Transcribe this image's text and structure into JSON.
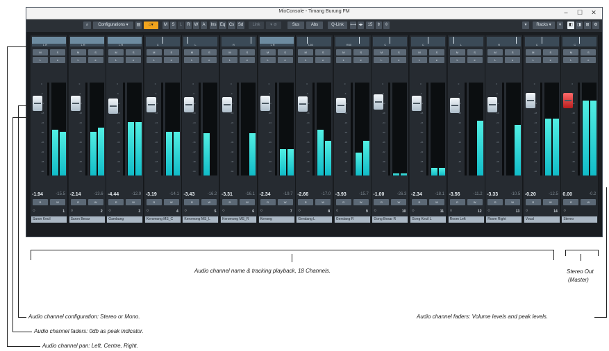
{
  "window": {
    "title": "MixConsole - Timang Burung FM",
    "controls": [
      "–",
      "☐",
      "✕"
    ]
  },
  "toolbar": {
    "configurations_label": "Configurations",
    "buttons_left": [
      "M",
      "S",
      "L",
      "R",
      "W",
      "A"
    ],
    "buttons_sections": [
      "Ins",
      "Eq",
      "Cs",
      "Sd"
    ],
    "link_label": "Link",
    "sus_label": "Sus",
    "abs_label": "Abs",
    "qlink_label": "Q-Link",
    "zoom_value": "15",
    "racks_label": "Racks",
    "colors": {
      "accent": "#f1a41d",
      "meter": "#22d3d8",
      "bg": "#1a1d21",
      "name_bg": "#aab7c4"
    }
  },
  "strip_buttons": {
    "mute": "M",
    "solo": "S",
    "listen": "L",
    "edit": "e",
    "read": "R",
    "write": "W"
  },
  "channels": [
    {
      "name": "Saron Kecil",
      "number": "1",
      "volume": "-1.94",
      "peak": "-15.5",
      "pan": "L R",
      "fader_db": -1.94,
      "meter": [
        0.5,
        0.48
      ]
    },
    {
      "name": "Saron Besar",
      "number": "2",
      "volume": "-2.14",
      "peak": "-13.6",
      "pan": "L R",
      "fader_db": -2.14,
      "meter": [
        0.48,
        0.52
      ]
    },
    {
      "name": "Gambang",
      "number": "3",
      "volume": "-4.44",
      "peak": "-12.9",
      "pan": "L R",
      "fader_db": -4.44,
      "meter": [
        0.58,
        0.58
      ]
    },
    {
      "name": "Keromong MS_C",
      "number": "4",
      "volume": "-3.19",
      "peak": "-14.1",
      "pan": "C",
      "fader_db": -3.19,
      "meter": [
        0.48,
        0.48
      ]
    },
    {
      "name": "Keromong MS_L",
      "number": "5",
      "volume": "-3.43",
      "peak": "-16.2",
      "pan": "L",
      "fader_db": -3.43,
      "meter": [
        0.46,
        0.0
      ]
    },
    {
      "name": "Keromong MS_R",
      "number": "6",
      "volume": "-3.31",
      "peak": "-16.1",
      "pan": "R",
      "fader_db": -3.31,
      "meter": [
        0.0,
        0.46
      ]
    },
    {
      "name": "Kenong",
      "number": "7",
      "volume": "-2.34",
      "peak": "-19.7",
      "pan": "L R",
      "fader_db": -2.34,
      "meter": [
        0.29,
        0.29
      ]
    },
    {
      "name": "Gendang L",
      "number": "8",
      "volume": "-2.66",
      "peak": "-17.0",
      "pan": "L50",
      "fader_db": -2.66,
      "meter": [
        0.5,
        0.38
      ]
    },
    {
      "name": "Gendang R",
      "number": "9",
      "volume": "-3.93",
      "peak": "-15.7",
      "pan": "R50",
      "fader_db": -3.93,
      "meter": [
        0.25,
        0.38
      ]
    },
    {
      "name": "Gong Besar R",
      "number": "10",
      "volume": "-1.00",
      "peak": "-26.3",
      "pan": "C",
      "fader_db": -1.0,
      "meter": [
        0.02,
        0.02
      ]
    },
    {
      "name": "Gong Kecil L",
      "number": "11",
      "volume": "-2.34",
      "peak": "-18.1",
      "pan": "C",
      "fader_db": -2.34,
      "meter": [
        0.08,
        0.08
      ]
    },
    {
      "name": "Room Left",
      "number": "12",
      "volume": "-3.56",
      "peak": "-11.2",
      "pan": "L",
      "fader_db": -3.56,
      "meter": [
        0.0,
        0.6
      ]
    },
    {
      "name": "Room Right",
      "number": "13",
      "volume": "-3.33",
      "peak": "-10.5",
      "pan": "R",
      "fader_db": -3.33,
      "meter": [
        0.0,
        0.55
      ]
    },
    {
      "name": "Vocal",
      "number": "14",
      "volume": "-0.20",
      "peak": "-12.5",
      "pan": "C",
      "fader_db": -0.2,
      "meter": [
        0.62,
        0.62
      ]
    },
    {
      "name": "Stereo",
      "number": "",
      "volume": "0.00",
      "peak": "-0.2",
      "pan": "C",
      "fader_db": 0.0,
      "meter": [
        0.82,
        0.82
      ],
      "master": true
    }
  ],
  "annotations": {
    "channels_brace": "Audio channel name & tracking playback, 18 Channels.",
    "stereo_out": "Stereo Out",
    "master": "(Master)",
    "config": "Audio channel configuration: Stereo or Mono.",
    "faders": "Audio channel faders: 0db as peak indicator.",
    "pan": "Audio channel pan: Left, Centre, Right.",
    "levels": "Audio channel faders: Volume levels and peak levels."
  }
}
